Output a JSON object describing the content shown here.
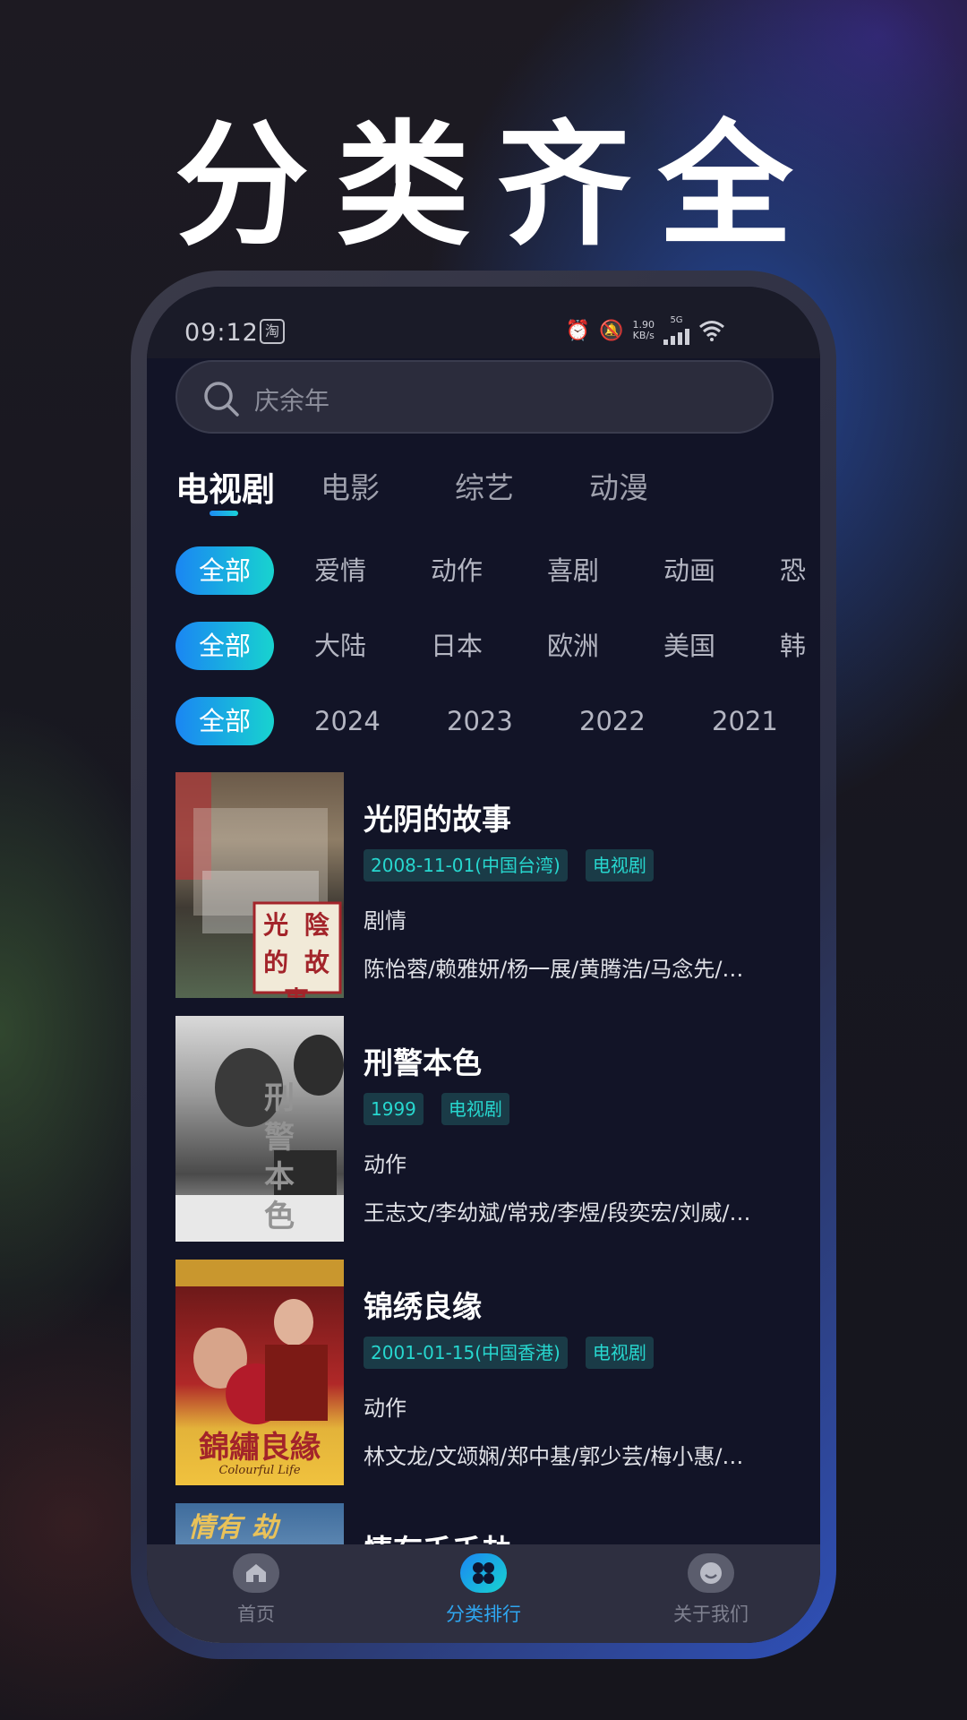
{
  "headline": "分类齐全",
  "status_bar": {
    "time": "09:12",
    "notification_badge": "淘",
    "network_speed": "1.90\nKB/s",
    "network_type": "5G"
  },
  "search": {
    "placeholder": "庆余年"
  },
  "category_tabs": [
    {
      "label": "电视剧",
      "active": true
    },
    {
      "label": "电影",
      "active": false
    },
    {
      "label": "综艺",
      "active": false
    },
    {
      "label": "动漫",
      "active": false
    }
  ],
  "filters": {
    "genre": [
      "全部",
      "爱情",
      "动作",
      "喜剧",
      "动画",
      "恐"
    ],
    "region": [
      "全部",
      "大陆",
      "日本",
      "欧洲",
      "美国",
      "韩"
    ],
    "year": [
      "全部",
      "2024",
      "2023",
      "2022",
      "2021"
    ]
  },
  "shows": [
    {
      "title": "光阴的故事",
      "date_tag": "2008-11-01(中国台湾)",
      "type_tag": "电视剧",
      "genre": "剧情",
      "cast": "陈怡蓉/赖雅妍/杨一展/黄腾浩/马念先/…",
      "poster_text": "光 陰 的 故 事"
    },
    {
      "title": "刑警本色",
      "date_tag": "1999",
      "type_tag": "电视剧",
      "genre": "动作",
      "cast": "王志文/李幼斌/常戎/李煜/段奕宏/刘威/…",
      "poster_text": "刑 警 本 色"
    },
    {
      "title": "锦绣良缘",
      "date_tag": "2001-01-15(中国香港)",
      "type_tag": "电视剧",
      "genre": "动作",
      "cast": "林文龙/文颂娴/郑中基/郭少芸/梅小惠/…",
      "poster_text": "錦繡良緣",
      "poster_subtext": "Colourful Life"
    },
    {
      "title": "情有千千劫",
      "poster_text": "情有 劫"
    }
  ],
  "bottom_nav": [
    {
      "label": "首页",
      "icon": "home-icon",
      "active": false
    },
    {
      "label": "分类排行",
      "icon": "category-icon",
      "active": true
    },
    {
      "label": "关于我们",
      "icon": "profile-icon",
      "active": false
    }
  ],
  "colors": {
    "accent_gradient_start": "#1a86f3",
    "accent_gradient_end": "#18d3cf",
    "tag_text": "#27d7cf",
    "tag_bg": "#1a3b47",
    "screen_bg": "#121427"
  }
}
